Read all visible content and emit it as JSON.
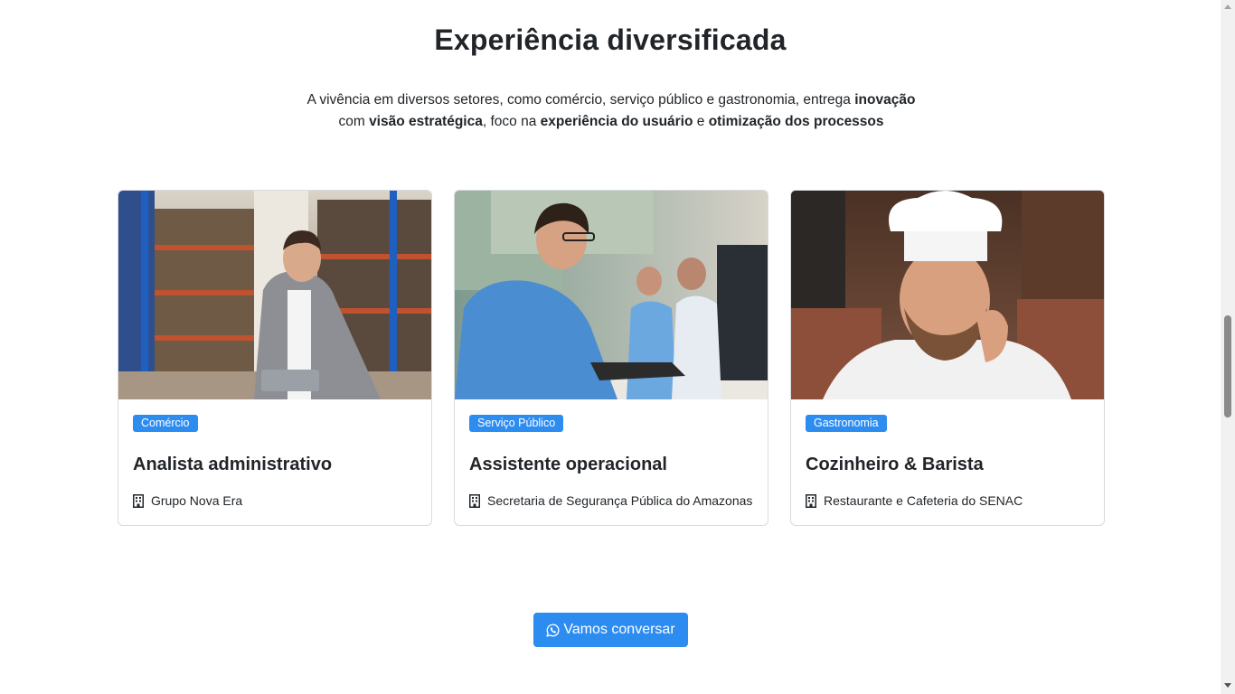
{
  "section": {
    "title": "Experiência diversificada",
    "lead": {
      "t1": "A vivência em diversos setores, como comércio, serviço público e gastronomia, entrega ",
      "b1": "inovação",
      "t2": "com ",
      "b2": "visão estratégica",
      "t3": ", foco na ",
      "b3": "experiência do usuário",
      "t4": " e ",
      "b4": "otimização dos processos"
    }
  },
  "cards": [
    {
      "badge": "Comércio",
      "title": "Analista administrativo",
      "org": "Grupo Nova Era",
      "image": "warehouse-manager-photo",
      "icon": "building-icon"
    },
    {
      "badge": "Serviço Público",
      "title": "Assistente operacional",
      "org": "Secretaria de Segurança Pública do Amazonas",
      "image": "office-workers-photo",
      "icon": "building-icon"
    },
    {
      "badge": "Gastronomia",
      "title": "Cozinheiro & Barista",
      "org": "Restaurante e Cafeteria do SENAC",
      "image": "chef-photo",
      "icon": "building-icon"
    }
  ],
  "cta": {
    "label": "Vamos conversar",
    "icon": "whatsapp-icon"
  },
  "colors": {
    "accent": "#2d8cf0",
    "text": "#212529",
    "card_border": "#d7dbe0"
  }
}
